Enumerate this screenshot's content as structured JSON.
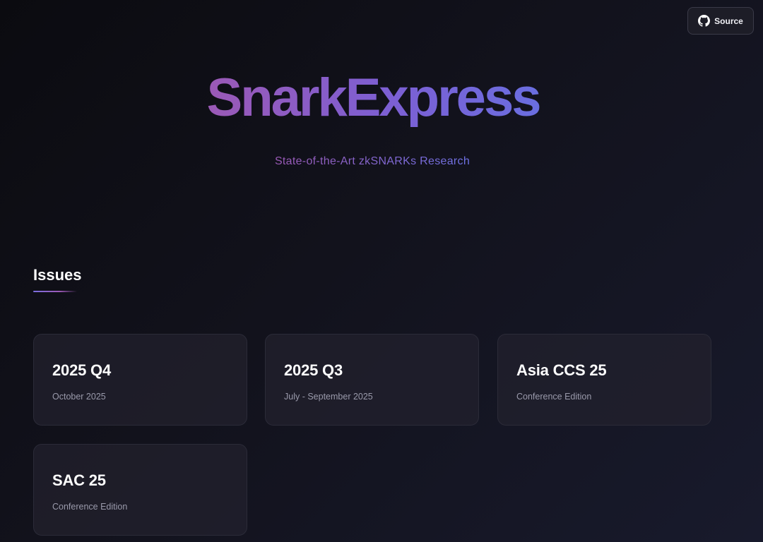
{
  "header": {
    "source_button": {
      "label": "Source",
      "icon": "github-icon"
    }
  },
  "hero": {
    "title": "SnarkExpress",
    "subtitle": "State-of-the-Art zkSNARKs Research"
  },
  "section": {
    "title": "Issues"
  },
  "issues": [
    {
      "title": "2025 Q4",
      "subtitle": "October 2025"
    },
    {
      "title": "2025 Q3",
      "subtitle": "July - September 2025"
    },
    {
      "title": "Asia CCS 25",
      "subtitle": "Conference Edition"
    },
    {
      "title": "SAC 25",
      "subtitle": "Conference Edition"
    }
  ],
  "colors": {
    "accent_start": "#9b59b6",
    "accent_end": "#6a6ee0",
    "card_bg": "#22212e",
    "muted_text": "#9a9aab"
  }
}
